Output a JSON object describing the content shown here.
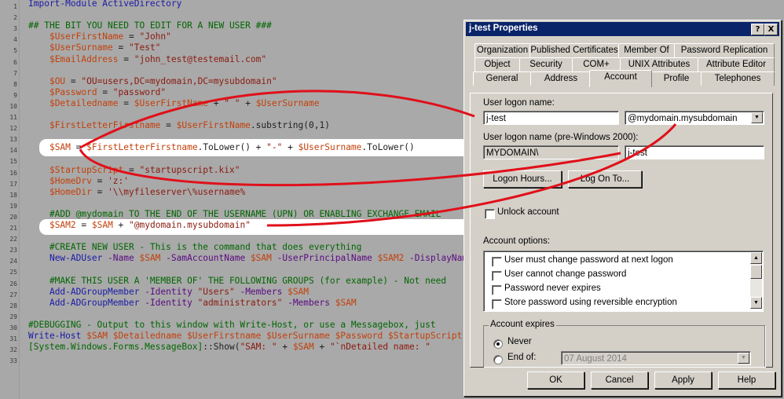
{
  "editor": {
    "line_numbers": [
      "1",
      "2",
      "3",
      "4",
      "5",
      "6",
      "7",
      "8",
      "9",
      "10",
      "11",
      "12",
      "13",
      "14",
      "15",
      "16",
      "17",
      "18",
      "19",
      "20",
      "21",
      "22",
      "23",
      "24",
      "25",
      "26",
      "27",
      "28",
      "29",
      "30",
      "31",
      "32",
      "33"
    ],
    "lines": [
      [
        {
          "t": "Import-Module ActiveDirectory",
          "c": "cmd"
        }
      ],
      [],
      [
        {
          "t": "## THE BIT YOU NEED TO EDIT FOR A NEW USER ###",
          "c": "comment"
        }
      ],
      [
        {
          "t": "    "
        },
        {
          "t": "$UserFirstName",
          "c": "var"
        },
        {
          "t": " = ",
          "c": "plain"
        },
        {
          "t": "\"John\"",
          "c": "str"
        }
      ],
      [
        {
          "t": "    "
        },
        {
          "t": "$UserSurname",
          "c": "var"
        },
        {
          "t": " = ",
          "c": "plain"
        },
        {
          "t": "\"Test\"",
          "c": "str"
        }
      ],
      [
        {
          "t": "    "
        },
        {
          "t": "$EmailAddress",
          "c": "var"
        },
        {
          "t": " = ",
          "c": "plain"
        },
        {
          "t": "\"john_test@testemail.com\"",
          "c": "str"
        }
      ],
      [],
      [
        {
          "t": "    "
        },
        {
          "t": "$OU",
          "c": "var"
        },
        {
          "t": " = ",
          "c": "plain"
        },
        {
          "t": "\"OU=users,DC=mydomain,DC=mysubdomain\"",
          "c": "str"
        }
      ],
      [
        {
          "t": "    "
        },
        {
          "t": "$Password",
          "c": "var"
        },
        {
          "t": " = ",
          "c": "plain"
        },
        {
          "t": "\"password\"",
          "c": "str"
        }
      ],
      [
        {
          "t": "    "
        },
        {
          "t": "$Detailedname",
          "c": "var"
        },
        {
          "t": " = ",
          "c": "plain"
        },
        {
          "t": "$UserFirstName",
          "c": "var"
        },
        {
          "t": " + ",
          "c": "plain"
        },
        {
          "t": "\" \"",
          "c": "str"
        },
        {
          "t": " + ",
          "c": "plain"
        },
        {
          "t": "$UserSurname",
          "c": "var"
        }
      ],
      [],
      [
        {
          "t": "    "
        },
        {
          "t": "$FirstLetterFirstname",
          "c": "var"
        },
        {
          "t": " = ",
          "c": "plain"
        },
        {
          "t": "$UserFirstName",
          "c": "var"
        },
        {
          "t": ".substring(0,1)",
          "c": "plain"
        }
      ],
      [],
      [
        {
          "t": "    "
        },
        {
          "t": "$SAM",
          "c": "var"
        },
        {
          "t": " = ",
          "c": "plain"
        },
        {
          "t": "$FirstLetterFirstname",
          "c": "var"
        },
        {
          "t": ".ToLower() + ",
          "c": "plain"
        },
        {
          "t": "\"-\"",
          "c": "str"
        },
        {
          "t": " + ",
          "c": "plain"
        },
        {
          "t": "$UserSurname",
          "c": "var"
        },
        {
          "t": ".ToLower()",
          "c": "plain"
        }
      ],
      [],
      [
        {
          "t": "    "
        },
        {
          "t": "$StartupScript",
          "c": "var"
        },
        {
          "t": " = ",
          "c": "plain"
        },
        {
          "t": "\"startupscript.kix\"",
          "c": "str"
        }
      ],
      [
        {
          "t": "    "
        },
        {
          "t": "$HomeDrv",
          "c": "var"
        },
        {
          "t": " = ",
          "c": "plain"
        },
        {
          "t": "'z:'",
          "c": "str"
        }
      ],
      [
        {
          "t": "    "
        },
        {
          "t": "$HomeDir",
          "c": "var"
        },
        {
          "t": " = ",
          "c": "plain"
        },
        {
          "t": "'\\\\myfileserver\\%username%",
          "c": "str"
        }
      ],
      [],
      [
        {
          "t": "    #ADD @mydomain TO THE END OF THE USERNAME (UPN) OR ENABLING EXCHANGE EMAIL",
          "c": "comment"
        }
      ],
      [
        {
          "t": "    "
        },
        {
          "t": "$SAM2",
          "c": "var"
        },
        {
          "t": " = ",
          "c": "plain"
        },
        {
          "t": "$SAM",
          "c": "var"
        },
        {
          "t": " + ",
          "c": "plain"
        },
        {
          "t": "\"@mydomain.mysubdomain\"",
          "c": "str"
        }
      ],
      [],
      [
        {
          "t": "    #CREATE NEW USER - This is the command that does everything",
          "c": "comment"
        }
      ],
      [
        {
          "t": "    "
        },
        {
          "t": "New-ADUser",
          "c": "cmd"
        },
        {
          "t": " -Name ",
          "c": "kw"
        },
        {
          "t": "$SAM",
          "c": "var"
        },
        {
          "t": " -SamAccountName ",
          "c": "kw"
        },
        {
          "t": "$SAM",
          "c": "var"
        },
        {
          "t": " -UserPrincipalName ",
          "c": "kw"
        },
        {
          "t": "$SAM2",
          "c": "var"
        },
        {
          "t": " -DisplayName",
          "c": "kw"
        }
      ],
      [],
      [
        {
          "t": "    #MAKE THIS USER A 'MEMBER OF' THE FOLLOWING GROUPS (for example) - Not need",
          "c": "comment"
        }
      ],
      [
        {
          "t": "    "
        },
        {
          "t": "Add-ADGroupMember",
          "c": "cmd"
        },
        {
          "t": " -Identity ",
          "c": "kw"
        },
        {
          "t": "\"Users\"",
          "c": "str"
        },
        {
          "t": " -Members ",
          "c": "kw"
        },
        {
          "t": "$SAM",
          "c": "var"
        }
      ],
      [
        {
          "t": "    "
        },
        {
          "t": "Add-ADGroupMember",
          "c": "cmd"
        },
        {
          "t": " -Identity ",
          "c": "kw"
        },
        {
          "t": "\"administrators\"",
          "c": "str"
        },
        {
          "t": " -Members ",
          "c": "kw"
        },
        {
          "t": "$SAM",
          "c": "var"
        }
      ],
      [],
      [
        {
          "t": "#DEBUGGING - Output to this window with Write-Host, or use a Messagebox, just",
          "c": "comment"
        }
      ],
      [
        {
          "t": "Write-Host ",
          "c": "cmd"
        },
        {
          "t": "$SAM $Detailedname $UserFirstname $UserSurname $Password $StartupScript",
          "c": "var"
        }
      ],
      [
        {
          "t": "[System.Windows.Forms.MessageBox]",
          "c": "comment"
        },
        {
          "t": "::Show(",
          "c": "plain"
        },
        {
          "t": "\"SAM: \"",
          "c": "str"
        },
        {
          "t": " + ",
          "c": "plain"
        },
        {
          "t": "$SAM",
          "c": "var"
        },
        {
          "t": " + ",
          "c": "plain"
        },
        {
          "t": "\"`nDetailed name: \"",
          "c": "str"
        }
      ],
      []
    ]
  },
  "dialog": {
    "title": "j-test Properties",
    "help_glyph": "?",
    "close_glyph": "X",
    "tabs_row1": [
      "Organization",
      "Published Certificates",
      "Member Of",
      "Password Replication"
    ],
    "tabs_row2": [
      "Object",
      "Security",
      "COM+",
      "UNIX Attributes",
      "Attribute Editor"
    ],
    "tabs_row3": [
      "General",
      "Address",
      "Account",
      "Profile",
      "Telephones"
    ],
    "active_tab": "Account",
    "logon_label": "User logon name:",
    "logon_value": "j-test",
    "upn_suffix": "@mydomain.mysubdomain",
    "pre2000_label": "User logon name (pre-Windows 2000):",
    "pre2000_domain": "MYDOMAIN\\",
    "pre2000_value": "j-test",
    "logon_hours_button": "Logon Hours...",
    "logon_to_button": "Log On To...",
    "unlock_label": "Unlock account",
    "unlock_checked": false,
    "account_options_label": "Account options:",
    "account_options": [
      {
        "label": "User must change password at next logon",
        "checked": false
      },
      {
        "label": "User cannot change password",
        "checked": false
      },
      {
        "label": "Password never expires",
        "checked": false
      },
      {
        "label": "Store password using reversible encryption",
        "checked": false
      }
    ],
    "expires_group": "Account expires",
    "never_label": "Never",
    "endof_label": "End of:",
    "expires_selected": "Never",
    "end_date": "07   August   2014",
    "buttons": {
      "ok": "OK",
      "cancel": "Cancel",
      "apply": "Apply",
      "help": "Help"
    }
  },
  "colors": {
    "annotation": "#e0101a",
    "highlight": "#ffffff",
    "title_bar": "#0a246a",
    "dialog_face": "#d4d0c8"
  }
}
